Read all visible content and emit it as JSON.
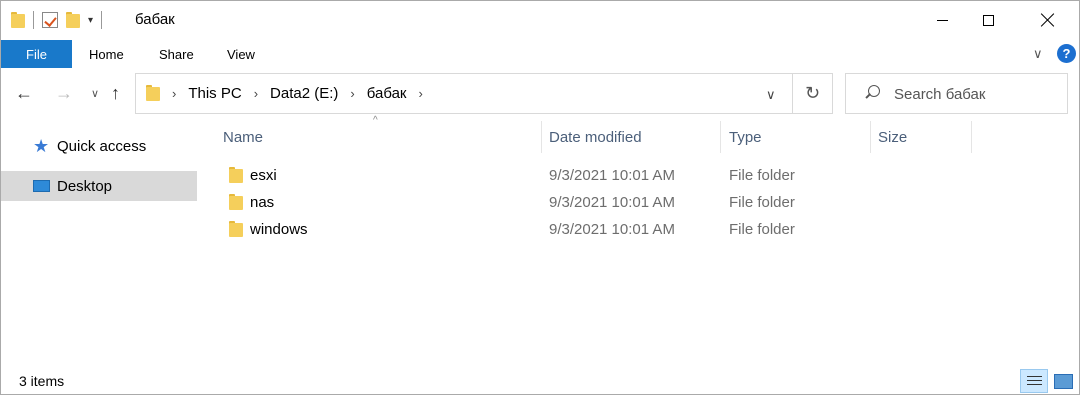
{
  "window": {
    "title": "бабак",
    "controls": [
      "minimize",
      "maximize",
      "close"
    ]
  },
  "quick_access_toolbar": {
    "icons": [
      "folder-icon",
      "properties-icon",
      "new-folder-icon",
      "customize-dropdown-icon"
    ],
    "dropdown_glyph": "▾"
  },
  "ribbon": {
    "file_label": "File",
    "tabs": [
      "Home",
      "Share",
      "View"
    ],
    "collapse_glyph": "∨",
    "help_glyph": "?"
  },
  "nav_buttons": {
    "back": "←",
    "forward": "→",
    "recent": "∨",
    "up": "↑"
  },
  "address": {
    "crumbs": [
      "This PC",
      "Data2 (E:)",
      "бабак"
    ],
    "separator": "›",
    "dropdown_glyph": "∨",
    "refresh_glyph": "↻"
  },
  "search": {
    "placeholder": "Search бабак"
  },
  "nav_pane": {
    "items": [
      {
        "label": "Quick access",
        "icon": "star-icon",
        "selected": false
      },
      {
        "label": "Desktop",
        "icon": "desktop-icon",
        "selected": true
      }
    ]
  },
  "columns": {
    "name": "Name",
    "date": "Date modified",
    "type": "Type",
    "size": "Size",
    "sort_glyph": "^"
  },
  "files": [
    {
      "name": "esxi",
      "date": "9/3/2021 10:01 AM",
      "type": "File folder",
      "size": ""
    },
    {
      "name": "nas",
      "date": "9/3/2021 10:01 AM",
      "type": "File folder",
      "size": ""
    },
    {
      "name": "windows",
      "date": "9/3/2021 10:01 AM",
      "type": "File folder",
      "size": ""
    }
  ],
  "status": {
    "item_count": "3 items",
    "active_view": "details"
  },
  "colors": {
    "file_tab": "#1979ca",
    "selected_nav": "#d9d9d9",
    "folder": "#f5cf5b",
    "header_text": "#4b5f7a"
  }
}
